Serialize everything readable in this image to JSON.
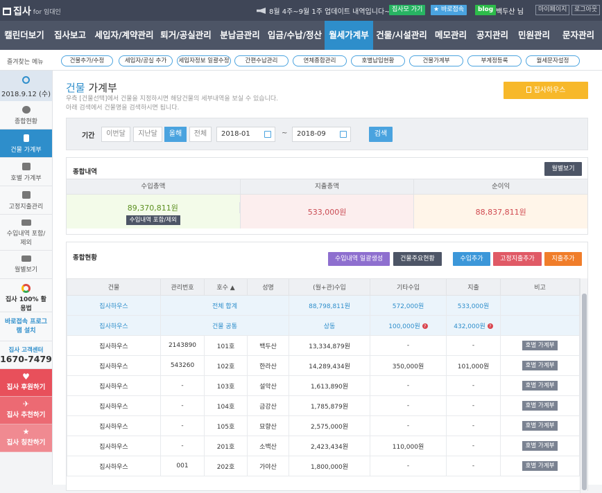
{
  "topbar": {
    "logo": "집사",
    "logo_for": "for 임대인",
    "notice": "8월 4주~9월 1주 업데이트 내역입니다~ ▶",
    "btn_notice": "집사모 가기",
    "btn_fav": "바로접속",
    "btn_blog": "blog",
    "user": "백두산 님",
    "btn_mypage": "마이페이지",
    "btn_logout": "로그아웃"
  },
  "nav": [
    "캘린더보기",
    "집사보고",
    "세입자/계약관리",
    "퇴거/공실관리",
    "분납금관리",
    "입금/수납/정산",
    "월세가계부",
    "건물/시설관리",
    "메모관리",
    "공지관리",
    "민원관리",
    "문자관리"
  ],
  "nav_active": 6,
  "fav_label": "즐겨찾는 메뉴",
  "favs": [
    "건물추가/수정",
    "세입자/공실 추가",
    "세입자정보 일괄수정",
    "간편수납관리",
    "연체종합관리",
    "호별납입현황",
    "건물가계부",
    "부계정등록",
    "월세문자설정"
  ],
  "sidebar": {
    "date": "2018.9.12 (수)",
    "items": [
      "종합현황",
      "건물 가계부",
      "호별 가계부",
      "고정지출관리",
      "수입내역 포함/제외",
      "월별보기"
    ],
    "active": 1,
    "app": "집사 100% 활용법",
    "remote": "바로접속 프로그램 설치",
    "cs_label": "집사 고객센터",
    "cs_phone": "1670-7479",
    "sponsor": "집사 후원하기",
    "recommend": "집사 추천하기",
    "praise": "집사 칭찬하기"
  },
  "page": {
    "title_a": "건물",
    "title_b": " 가계부",
    "desc1": "우측 [건물선택]에서 건물을 지정하시면 해당건물의 세부내역을 보실 수 있습니다.",
    "desc2": "아래 검색에서 건물명을 검색하시면 됩니다.",
    "building_btn": "집사하우스"
  },
  "filter": {
    "label": "기간",
    "this_month": "이번달",
    "last_month": "지난달",
    "year": "올해",
    "all": "전체",
    "from": "2018-01",
    "to": "2018-09",
    "sep": "~",
    "search": "검색"
  },
  "summary": {
    "title": "종합내역",
    "monthly_btn": "월별보기",
    "headers": [
      "수입총액",
      "지출총액",
      "순이익"
    ],
    "income": "89,370,811원",
    "income_btn": "수입내역 포함/제외",
    "expense": "533,000원",
    "net": "88,837,811원"
  },
  "status": {
    "title": "종합현황",
    "btn_bulk": "수입내역 일괄생성",
    "btn_main": "건물주요현황",
    "btn_add_in": "수입추가",
    "btn_add_fixed": "고정지출추가",
    "btn_add_out": "지출추가",
    "headers": [
      "건물",
      "관리번호",
      "호수 ▲",
      "성명",
      "(월+관)수입",
      "기타수입",
      "지출",
      "비고"
    ],
    "total": {
      "building": "집사하우스",
      "label": "전체 합계",
      "income": "88,798,811원",
      "other": "572,000원",
      "expense": "533,000원"
    },
    "common": {
      "building": "집사하우스",
      "label": "건물 공통",
      "name": "상동",
      "other": "100,000원",
      "expense": "432,000원"
    },
    "rows": [
      {
        "building": "집사하우스",
        "no": "2143890",
        "unit": "101호",
        "name": "백두산",
        "income": "13,334,879원",
        "other": "-",
        "expense": "-",
        "btn": "호별 가계부"
      },
      {
        "building": "집사하우스",
        "no": "543260",
        "unit": "102호",
        "name": "한라산",
        "income": "14,289,434원",
        "other": "350,000원",
        "expense": "101,000원",
        "btn": "호별 가계부"
      },
      {
        "building": "집사하우스",
        "no": "-",
        "unit": "103호",
        "name": "설악산",
        "income": "1,613,890원",
        "other": "-",
        "expense": "-",
        "btn": "호별 가계부"
      },
      {
        "building": "집사하우스",
        "no": "-",
        "unit": "104호",
        "name": "금강산",
        "income": "1,785,879원",
        "other": "-",
        "expense": "-",
        "btn": "호별 가계부"
      },
      {
        "building": "집사하우스",
        "no": "-",
        "unit": "105호",
        "name": "묘향산",
        "income": "2,575,000원",
        "other": "-",
        "expense": "-",
        "btn": "호별 가계부"
      },
      {
        "building": "집사하우스",
        "no": "-",
        "unit": "201호",
        "name": "소백산",
        "income": "2,423,434원",
        "other": "110,000원",
        "expense": "-",
        "btn": "호별 가계부"
      },
      {
        "building": "집사하우스",
        "no": "001",
        "unit": "202호",
        "name": "가야산",
        "income": "1,800,000원",
        "other": "-",
        "expense": "-",
        "btn": "호별 가계부"
      }
    ]
  }
}
